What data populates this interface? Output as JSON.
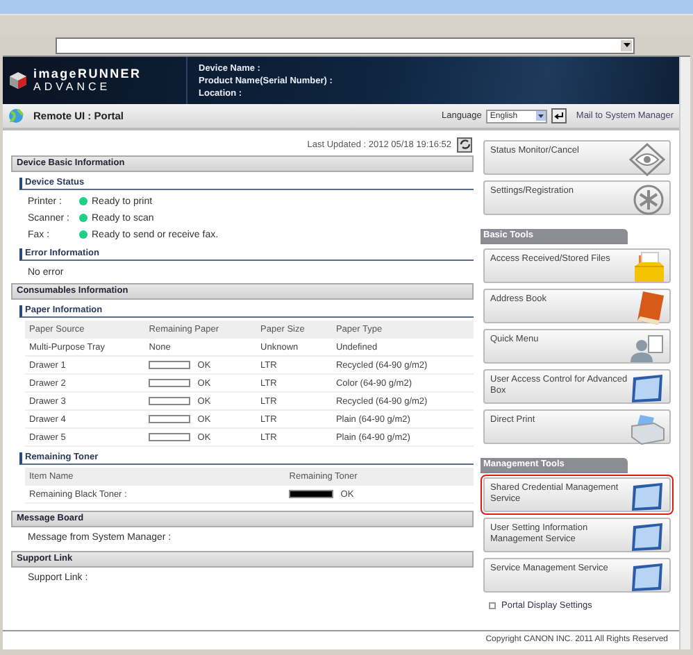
{
  "header": {
    "logo_line1": "imageRUNNER",
    "logo_line2": "ADVANCE",
    "device_labels": [
      "Device Name :",
      "Product Name(Serial Number) :",
      "Location :"
    ]
  },
  "portal_bar": {
    "title": "Remote UI : Portal",
    "language_label": "Language",
    "language_value": "English",
    "mail_link": "Mail to System Manager"
  },
  "last_updated": "Last Updated : 2012 05/18 19:16:52",
  "device_basic": {
    "title": "Device Basic Information",
    "status_title": "Device Status",
    "status": [
      {
        "label": "Printer :",
        "text": "Ready to print",
        "color": "#1fd08c"
      },
      {
        "label": "Scanner :",
        "text": "Ready to scan",
        "color": "#1fd08c"
      },
      {
        "label": "Fax :",
        "text": "Ready to send or receive fax.",
        "color": "#1fd08c"
      }
    ],
    "error_title": "Error Information",
    "error_text": "No error"
  },
  "consumables": {
    "title": "Consumables Information",
    "paper_title": "Paper Information",
    "paper_columns": [
      "Paper Source",
      "Remaining Paper",
      "Paper Size",
      "Paper Type"
    ],
    "paper_rows": [
      {
        "kind": "text",
        "source": "Multi-Purpose Tray",
        "remaining": "None",
        "size": "Unknown",
        "type": "Undefined"
      },
      {
        "kind": "bar",
        "source": "Drawer 1",
        "level": 0,
        "remaining": "OK",
        "size": "LTR",
        "type": "Recycled (64-90 g/m2)"
      },
      {
        "kind": "bar",
        "source": "Drawer 2",
        "level": 0,
        "remaining": "OK",
        "size": "LTR",
        "type": "Color (64-90 g/m2)"
      },
      {
        "kind": "bar",
        "source": "Drawer 3",
        "level": 0,
        "remaining": "OK",
        "size": "LTR",
        "type": "Recycled (64-90 g/m2)"
      },
      {
        "kind": "bar",
        "source": "Drawer 4",
        "level": 0,
        "remaining": "OK",
        "size": "LTR",
        "type": "Plain (64-90 g/m2)"
      },
      {
        "kind": "bar",
        "source": "Drawer 5",
        "level": 0,
        "remaining": "OK",
        "size": "LTR",
        "type": "Plain (64-90 g/m2)"
      }
    ],
    "toner_title": "Remaining Toner",
    "toner_columns": [
      "Item Name",
      "Remaining Toner"
    ],
    "toner_rows": [
      {
        "name": "Remaining Black Toner :",
        "level": 1,
        "remaining": "OK"
      }
    ]
  },
  "message_board": {
    "title": "Message Board",
    "text": "Message from System Manager :"
  },
  "support": {
    "title": "Support Link",
    "text": "Support Link :"
  },
  "top_buttons": [
    {
      "label": "Status Monitor/Cancel",
      "kind": "eye"
    },
    {
      "label": "Settings/Registration",
      "kind": "gear"
    }
  ],
  "basic_tools": {
    "title": "Basic Tools",
    "buttons": [
      {
        "label": "Access Received/Stored Files",
        "kind": "files"
      },
      {
        "label": "Address Book",
        "kind": "book"
      },
      {
        "label": "Quick Menu",
        "kind": "person"
      },
      {
        "label": "User Access Control for Advanced Box",
        "kind": "monitor"
      },
      {
        "label": "Direct Print",
        "kind": "printer"
      }
    ]
  },
  "management_tools": {
    "title": "Management Tools",
    "buttons": [
      {
        "label": "Shared Credential Management Service",
        "kind": "monitor",
        "highlighted": true
      },
      {
        "label": "User Setting Information Management Service",
        "kind": "monitor",
        "highlighted": false
      },
      {
        "label": "Service Management Service",
        "kind": "monitor",
        "highlighted": false
      }
    ]
  },
  "portal_settings_link": "Portal Display Settings",
  "copyright": "Copyright CANON INC. 2011 All Rights Reserved"
}
